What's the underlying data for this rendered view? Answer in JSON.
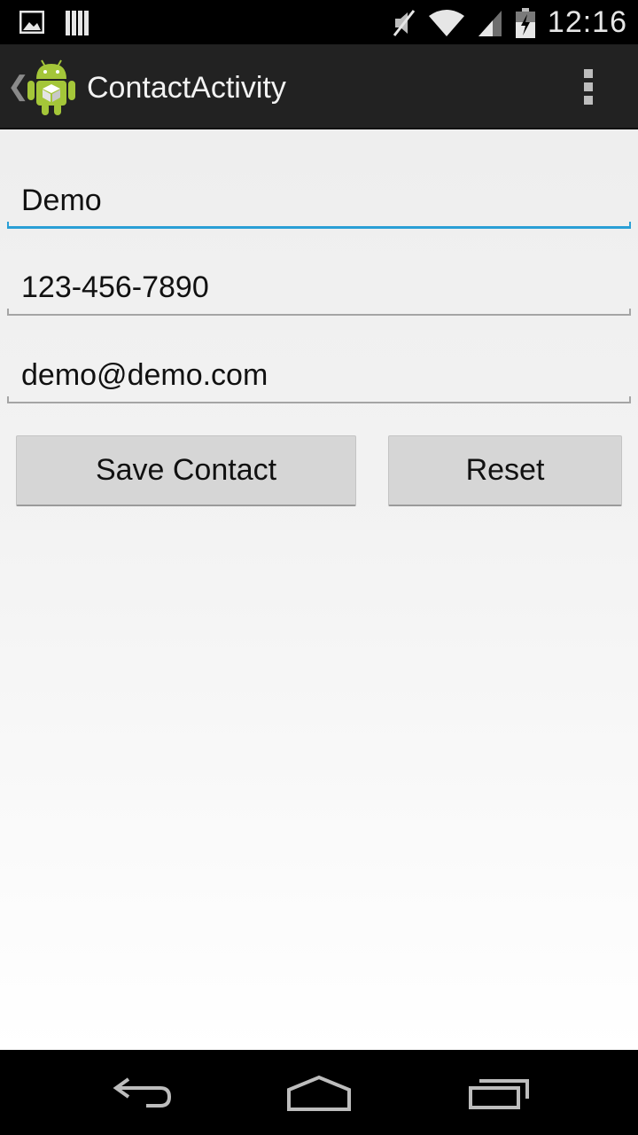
{
  "status_bar": {
    "time": "12:16",
    "icons": [
      "gallery-icon",
      "storage-icon",
      "mute-icon",
      "wifi-icon",
      "signal-icon",
      "battery-charging-icon"
    ]
  },
  "action_bar": {
    "title": "ContactActivity",
    "icons": [
      "up-caret-icon",
      "android-app-icon",
      "overflow-menu-icon"
    ]
  },
  "form": {
    "name_value": "Demo",
    "phone_value": "123-456-7890",
    "email_value": "demo@demo.com",
    "save_label": "Save Contact",
    "reset_label": "Reset"
  },
  "nav_bar": {
    "icons": [
      "back-icon",
      "home-icon",
      "recents-icon"
    ]
  },
  "colors": {
    "accent_focus": "#2a9fd6",
    "action_bar_bg": "#222222",
    "button_bg": "#d6d6d6",
    "android_green": "#a4c639"
  }
}
